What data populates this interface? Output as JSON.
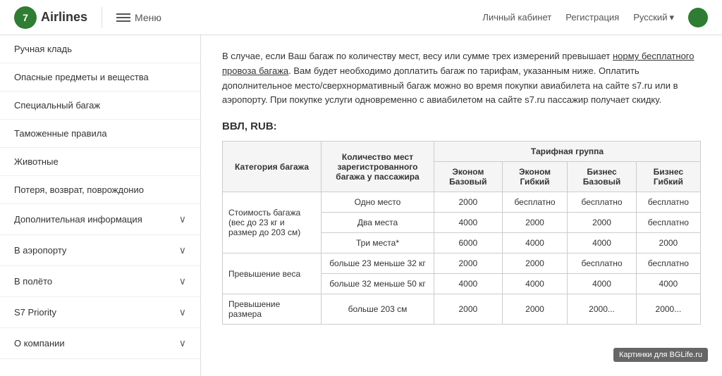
{
  "header": {
    "logo_number": "7",
    "logo_text": "Airlines",
    "menu_label": "Меню",
    "nav_items": [
      "Личный кабинет",
      "Регистрация"
    ],
    "lang_label": "Русский"
  },
  "sidebar": {
    "items": [
      {
        "label": "Ручная кладь"
      },
      {
        "label": "Опасные предметы и вещества"
      },
      {
        "label": "Специальный багаж"
      },
      {
        "label": "Таможенные правила"
      },
      {
        "label": "Животные"
      },
      {
        "label": "Потеря, возврат, поврождонио"
      }
    ],
    "sections": [
      {
        "label": "Дополнительная информация",
        "active": false
      },
      {
        "label": "В аэропорту",
        "active": false
      },
      {
        "label": "В полёто",
        "active": false
      },
      {
        "label": "S7 Priority",
        "active": false
      },
      {
        "label": "О компании",
        "active": false
      }
    ]
  },
  "content": {
    "intro": "В случае, если Ваш багаж по количеству мест, весу или сумме трех измерений превышает норму бесплатного провоза багажа. Вам будет необходимо доплатить багаж по тарифам, указанным ниже. Оплатить дополнительное место/сверхнормативный багаж можно во время покупки авиабилета на сайте s7.ru или в аэропорту. При покупке услуги одновременно с авиабилетом на сайте s7.ru пассажир получает скидку.",
    "underline_text": "норму бесплатного провоза багажа",
    "section_title": "ВВЛ, RUB:",
    "table": {
      "header_col1": "Категория багажа",
      "header_col2": "Количество мест зарегистрованного багажа у пассажира",
      "tariff_group": "Тарифная группа",
      "tariff_cols": [
        "Эконом Базовый",
        "Эконом Гибкий",
        "Бизнес Базовый",
        "Бизнес Гибкий"
      ],
      "rows": [
        {
          "category": "Стоимость багажа (вес до 23 кг и размер до 203 см)",
          "rowspan": 3,
          "sub_rows": [
            {
              "qty": "Одно место",
              "values": [
                "2000",
                "бесплатно",
                "бесплатно",
                "бесплатно"
              ]
            },
            {
              "qty": "Два места",
              "values": [
                "4000",
                "2000",
                "2000",
                "бесплатно"
              ]
            },
            {
              "qty": "Три места*",
              "values": [
                "6000",
                "4000",
                "4000",
                "2000"
              ]
            }
          ]
        },
        {
          "category": "Превышение веса",
          "rowspan": 2,
          "sub_rows": [
            {
              "qty": "больше 23 меньше 32 кг",
              "values": [
                "2000",
                "2000",
                "бесплатно",
                "бесплатно"
              ]
            },
            {
              "qty": "больше 32 меньше 50 кг",
              "values": [
                "4000",
                "4000",
                "4000",
                "4000"
              ]
            }
          ]
        },
        {
          "category": "Превышение размера",
          "rowspan": 1,
          "sub_rows": [
            {
              "qty": "больше 203 см",
              "values": [
                "2000",
                "2000",
                "2000...",
                "2000..."
              ]
            }
          ]
        }
      ]
    }
  },
  "watermark": "Картинки для BGLife.ru",
  "priority_label": "87 Priority"
}
